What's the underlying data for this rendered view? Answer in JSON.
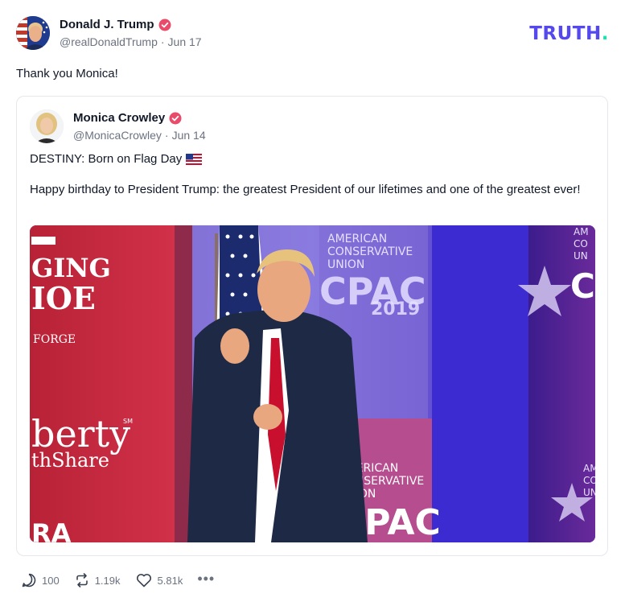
{
  "author": {
    "name": "Donald J. Trump",
    "handle": "@realDonaldTrump",
    "date": "Jun 17"
  },
  "brand": {
    "wordmark": "TRUTH",
    "dot": ".",
    "primary_color": "#5448ee",
    "accent_color": "#17e3b3"
  },
  "post": {
    "text": "Thank you Monica!"
  },
  "quoted": {
    "name": "Monica Crowley",
    "handle": "@MonicaCrowley",
    "date": "Jun 14",
    "line1": "DESTINY: Born on Flag Day",
    "line1_emoji": "us-flag-emoji",
    "body": "Happy birthday to President Trump: the greatest President of our lifetimes and one of the greatest ever!",
    "image": {
      "sign_left_1": "GING",
      "sign_left_2": "IOE",
      "sign_left_3": "FORGE",
      "sign_left_4": "berty",
      "sign_left_5": "thShare",
      "sign_left_6": "SM",
      "sign_left_7": "RA",
      "sign_mid_1": "AMERICAN",
      "sign_mid_2": "CONSERVATIVE",
      "sign_mid_3": "UNION",
      "sign_mid_4": "CPAC",
      "sign_mid_5": "2019",
      "sign_low_1": "AMERICAN",
      "sign_low_2": "CONSERVATIVE",
      "sign_low_3": "UNION",
      "sign_low_4": "CPAC",
      "sign_right_1": "AM",
      "sign_right_2": "CO",
      "sign_right_3": "UN",
      "sign_right_4": "C",
      "sign_right_5": "AM",
      "sign_right_6": "CO",
      "sign_right_7": "UN"
    }
  },
  "actions": {
    "replies": "100",
    "retruths": "1.19k",
    "likes": "5.81k",
    "more": "•••"
  },
  "colors": {
    "verified": "#e94b6a",
    "text": "#111827",
    "muted": "#6b7280",
    "border": "#e5e7eb"
  }
}
